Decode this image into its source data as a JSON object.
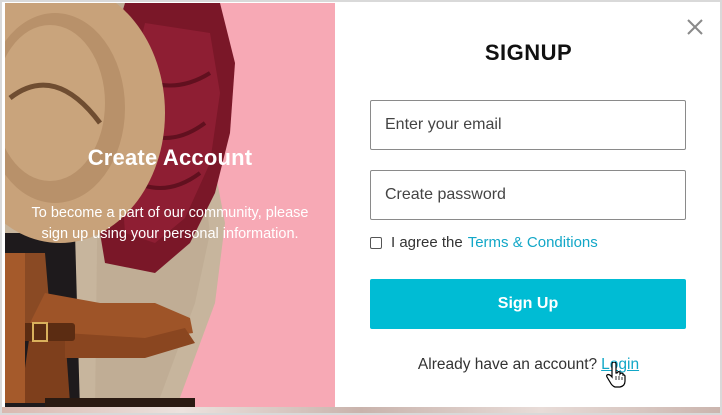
{
  "left_panel": {
    "title": "Create Account",
    "description": "To become a part of our community, please sign up using your personal information."
  },
  "form": {
    "title": "SIGNUP",
    "email_placeholder": "Enter your email",
    "password_placeholder": "Create password",
    "agree_text": "I agree the",
    "terms_link": "Terms & Conditions",
    "signup_button": "Sign Up",
    "login_prompt": "Already have an account?",
    "login_link": "Login"
  },
  "colors": {
    "accent": "#00bcd4",
    "link": "#12a7c7",
    "left_background": "#f5a7b3"
  },
  "icons": {
    "close": "close-icon",
    "cursor": "hand-pointer-icon"
  }
}
